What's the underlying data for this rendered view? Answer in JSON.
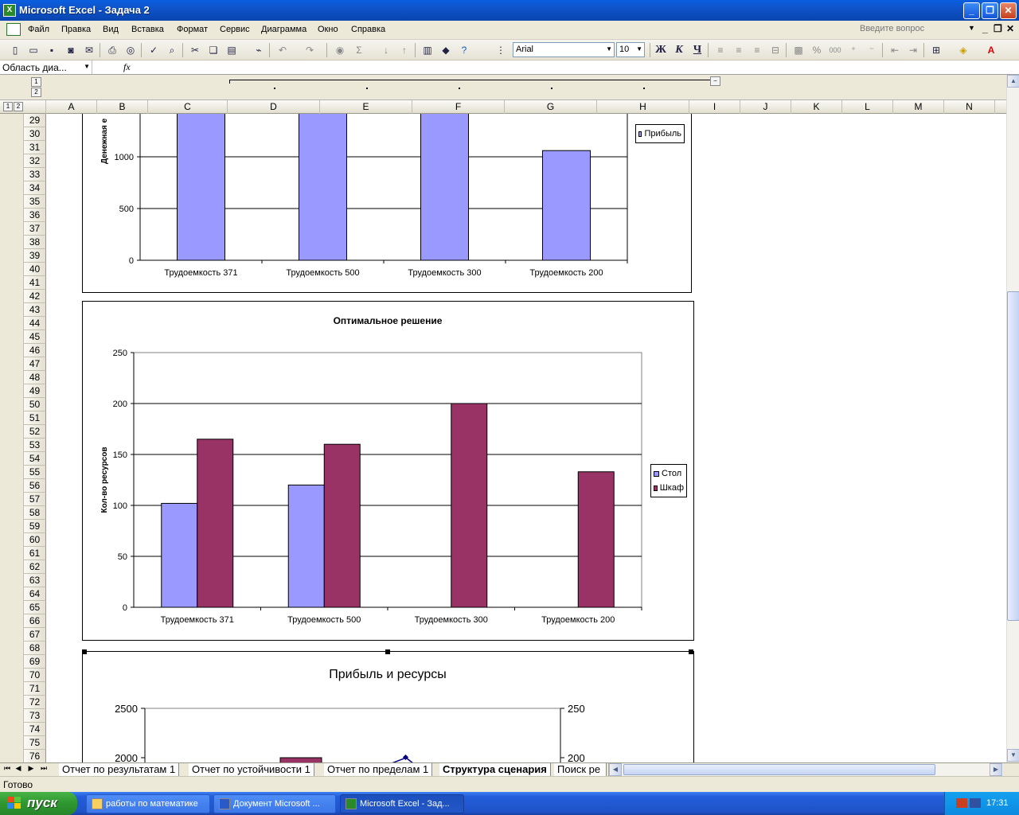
{
  "window": {
    "title": "Microsoft Excel - Задача 2",
    "buttons": {
      "minimize": "_",
      "maximize": "❐",
      "close": "✕"
    }
  },
  "menu": {
    "items": [
      "Файл",
      "Правка",
      "Вид",
      "Вставка",
      "Формат",
      "Сервис",
      "Диаграмма",
      "Окно",
      "Справка"
    ],
    "ask_placeholder": "Введите вопрос"
  },
  "toolbar": {
    "font": "Arial",
    "size": "10",
    "bold": "Ж",
    "italic": "К",
    "underline": "Ч",
    "percent": "%",
    "thousands": "000"
  },
  "formula_bar": {
    "name_box": "Область диа...",
    "fx": "fx"
  },
  "outline": {
    "level1": "1",
    "level2": "2",
    "collapse": "−"
  },
  "columns": [
    "A",
    "B",
    "C",
    "D",
    "E",
    "F",
    "G",
    "H",
    "I",
    "J",
    "K",
    "L",
    "M",
    "N"
  ],
  "rows": [
    "29",
    "30",
    "31",
    "32",
    "33",
    "34",
    "35",
    "36",
    "37",
    "38",
    "39",
    "40",
    "41",
    "42",
    "43",
    "44",
    "45",
    "46",
    "47",
    "48",
    "49",
    "50",
    "51",
    "52",
    "53",
    "54",
    "55",
    "56",
    "57",
    "58",
    "59",
    "60",
    "61",
    "62",
    "63",
    "64",
    "65",
    "66",
    "67",
    "68",
    "69",
    "70",
    "71",
    "72",
    "73",
    "74",
    "75",
    "76"
  ],
  "charts": {
    "profit": {
      "ylabel": "Денежная е",
      "legend": "Прибыль",
      "color": "#9999ff"
    },
    "optimal": {
      "title": "Оптимальное решение",
      "ylabel": "Кол-во ресурсов",
      "legend": [
        "Стол",
        "Шкаф"
      ],
      "colors": [
        "#9999ff",
        "#993366"
      ]
    },
    "resources": {
      "title": "Прибыль и ресурсы"
    }
  },
  "chart_data": [
    {
      "type": "bar",
      "categories": [
        "Трудоемкость 371",
        "Трудоемкость 500",
        "Трудоемкость 300",
        "Трудоемкость 200"
      ],
      "series": [
        {
          "name": "Прибыль",
          "values": [
            1500,
            1500,
            1500,
            1060
          ]
        }
      ],
      "ylabel": "Денежная е",
      "ylim": [
        0,
        1500
      ],
      "yticks": [
        0,
        500,
        1000
      ],
      "note": "top of chart scrolled out of view; first three bars exceed visible area"
    },
    {
      "type": "bar",
      "title": "Оптимальное решение",
      "categories": [
        "Трудоемкость 371",
        "Трудоемкость 500",
        "Трудоемкость 300",
        "Трудоемкость 200"
      ],
      "series": [
        {
          "name": "Стол",
          "values": [
            102,
            120,
            0,
            0
          ]
        },
        {
          "name": "Шкаф",
          "values": [
            165,
            160,
            200,
            133
          ]
        }
      ],
      "ylabel": "Кол-во ресурсов",
      "ylim": [
        0,
        250
      ],
      "yticks": [
        0,
        50,
        100,
        150,
        200,
        250
      ],
      "grid": true,
      "legend": "right"
    },
    {
      "type": "bar",
      "title": "Прибыль и ресурсы",
      "yticks_left": [
        2000,
        2500
      ],
      "yticks_right": [
        200,
        250
      ]
    }
  ],
  "sheets": {
    "tabs": [
      "Отчет по результатам 1",
      "Отчет по устойчивости 1",
      "Отчет по пределам 1",
      "Структура сценария",
      "Поиск ре"
    ],
    "active": 3
  },
  "status": "Готово",
  "taskbar": {
    "start": "пуск",
    "tasks": [
      "работы по математике",
      "Документ Microsoft ...",
      "Microsoft Excel - Зад..."
    ],
    "clock": "17:31"
  }
}
